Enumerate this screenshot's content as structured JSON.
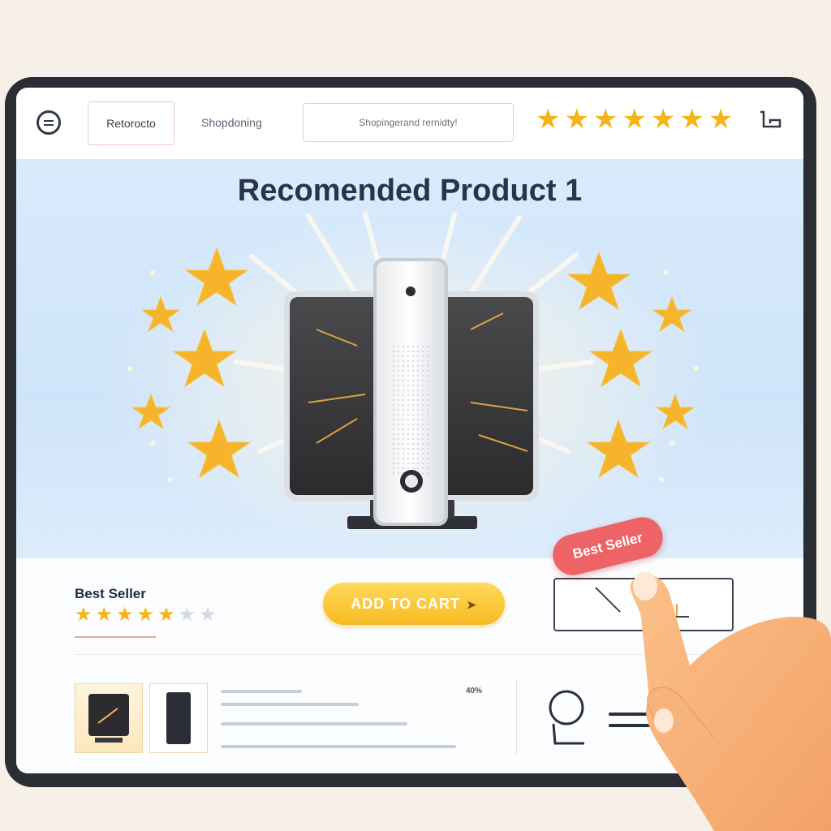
{
  "header": {
    "nav_item_1": "Retorocto",
    "nav_item_2": "Shopdoning",
    "search_value": "Shopingerand rernidty!",
    "top_rating_stars": 7
  },
  "hero": {
    "title": "Recomended Product 1"
  },
  "product": {
    "badge_label": "Best Seller",
    "rating": {
      "filled": 5,
      "total": 7
    },
    "add_to_cart_label": "ADD TO CART",
    "best_seller_tag": "Best Seller",
    "discount": "40%"
  },
  "colors": {
    "accent_yellow": "#f7bb22",
    "star": "#f5b418",
    "tag_red": "#ee6366",
    "hero_bg": "#d9ebfb"
  },
  "icons": [
    "menu-icon",
    "cart-icon",
    "star-icon",
    "magnifier-icon",
    "hand-pointer-icon"
  ]
}
